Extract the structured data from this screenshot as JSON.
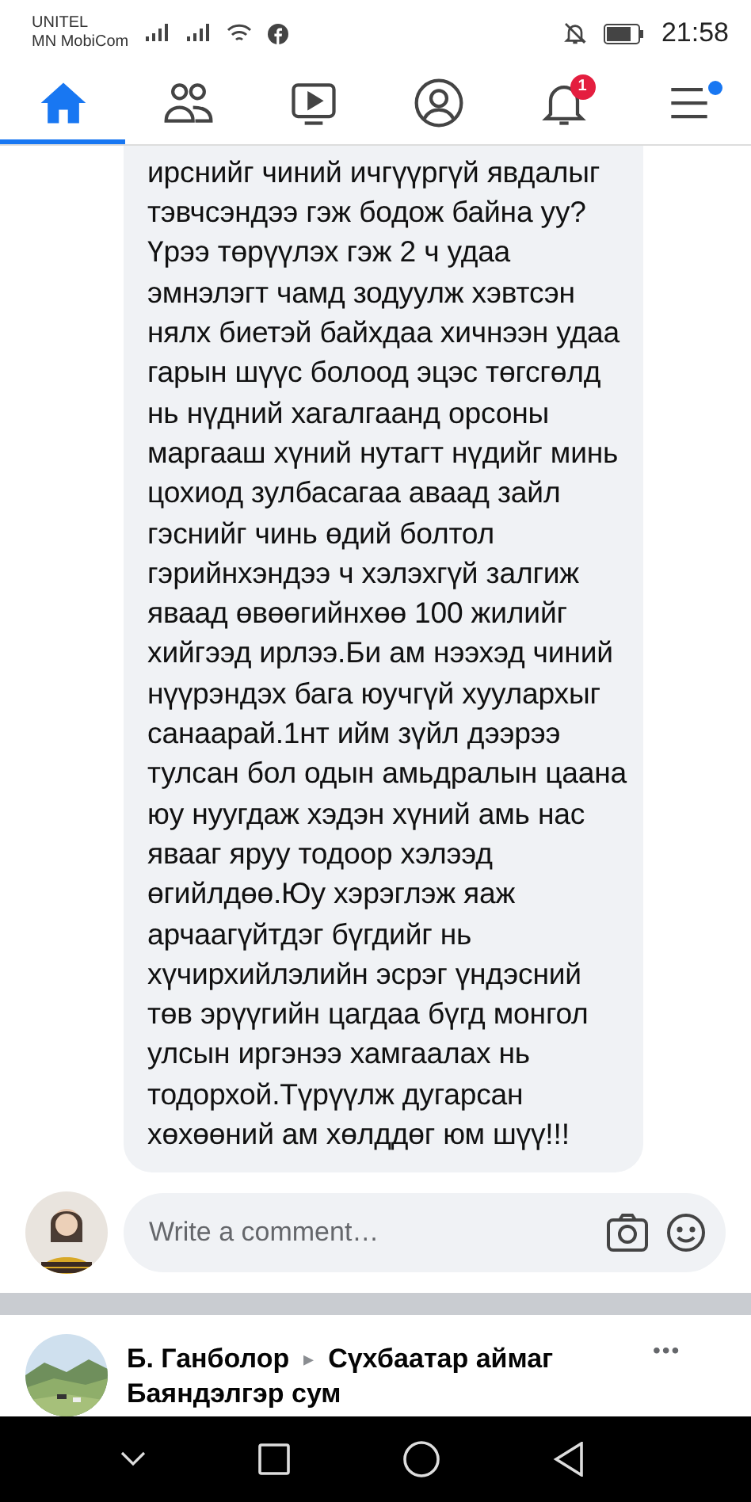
{
  "status_bar": {
    "carriers": [
      "UNITEL",
      "MN MobiCom"
    ],
    "time": "21:58"
  },
  "nav_tabs": [
    {
      "kind": "home",
      "selected": true
    },
    {
      "kind": "friends",
      "selected": false
    },
    {
      "kind": "watch",
      "selected": false
    },
    {
      "kind": "profile",
      "selected": false
    },
    {
      "kind": "notifications",
      "selected": false,
      "badge": "1"
    },
    {
      "kind": "menu",
      "selected": false,
      "dot": true
    }
  ],
  "comment": {
    "lines": [
      "ирснийг чиний ичгүүргүй явдалыг",
      "тэвчсэндээ гэж бодож байна уу?",
      "Үрээ төрүүлэх гэж 2 ч удаа",
      "эмнэлэгт чамд зодуулж хэвтсэн",
      "нялх биетэй байхдаа хичнээн удаа",
      "гарын шүүс болоод эцэс төгсгөлд",
      "нь нүдний хагалгаанд орсоны",
      "маргааш хүний нутагт нүдийг минь",
      "цохиод зулбасагаа аваад зайл",
      "гэснийг чинь өдий болтол",
      "гэрийнхэндээ ч хэлэхгүй залгиж",
      "яваад өвөөгийнхөө 100 жилийг",
      "хийгээд ирлээ.Би ам нээхэд чиний",
      "нүүрэндэх бага юучгүй хуулархыг",
      "санаарай.1нт ийм зүйл дээрээ",
      "тулсан бол одын амьдралын цаана",
      "юу нуугдаж хэдэн хүний амь нас",
      "явааг яруу тодоор хэлээд",
      "өгийлдөө.Юу хэрэглэж яаж",
      "арчаагүйтдэг бүгдийг нь",
      "хүчирхийлэлийн эсрэг үндэсний",
      "төв эрүүгийн цагдаа бүгд монгол",
      "улсын иргэнээ хамгаалах нь",
      "тодорхой.Түрүүлж дугарсан",
      "хөхөөний ам хөлддөг юм шүү!!!"
    ]
  },
  "composer": {
    "placeholder": "Write a comment…"
  },
  "post": {
    "author": "Б. Ганболор",
    "separator": "▸",
    "target": "Сүхбаатар аймаг Баяндэлгэр сум",
    "more": "•••"
  }
}
